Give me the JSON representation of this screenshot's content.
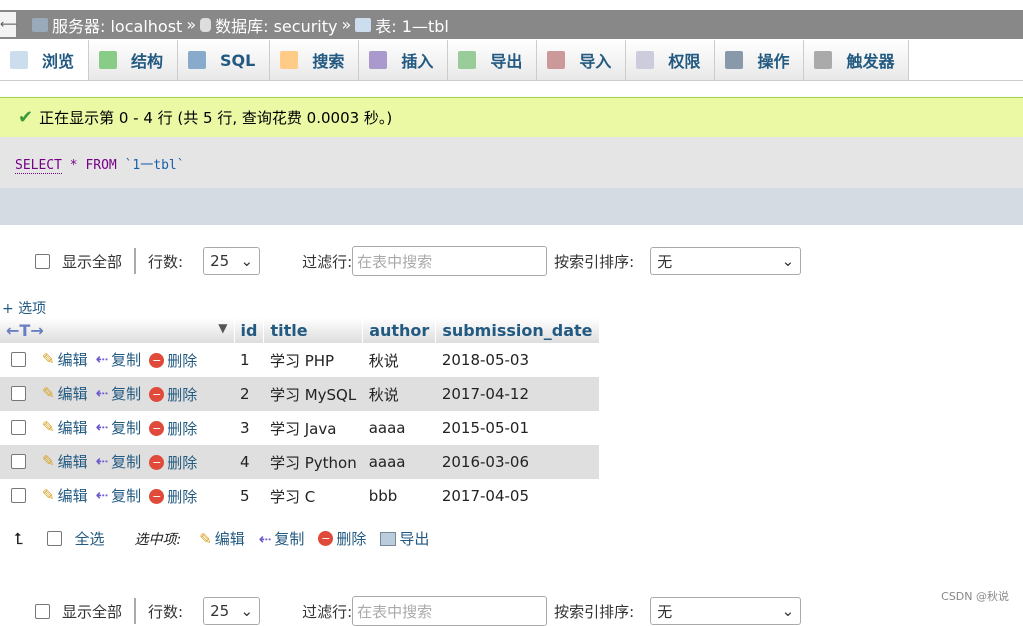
{
  "breadcrumb": {
    "server": "服务器: localhost",
    "database": "数据库: security",
    "table": "表: 1—tbl",
    "sep": "»"
  },
  "tabs": [
    {
      "label": "浏览",
      "icon": "browse-icon"
    },
    {
      "label": "结构",
      "icon": "structure-icon"
    },
    {
      "label": "SQL",
      "icon": "sql-icon"
    },
    {
      "label": "搜索",
      "icon": "search-icon"
    },
    {
      "label": "插入",
      "icon": "insert-icon"
    },
    {
      "label": "导出",
      "icon": "export-icon"
    },
    {
      "label": "导入",
      "icon": "import-icon"
    },
    {
      "label": "权限",
      "icon": "privileges-icon"
    },
    {
      "label": "操作",
      "icon": "wrench-icon"
    },
    {
      "label": "触发器",
      "icon": "triggers-icon"
    }
  ],
  "message": "正在显示第 0 - 4 行 (共 5 行, 查询花费 0.0003 秒。)",
  "sql": {
    "select": "SELECT",
    "star": "*",
    "from": "FROM",
    "table": "`1一tbl`"
  },
  "controls": {
    "show_all": "显示全部",
    "rows_label": "行数:",
    "rows_value": "25",
    "filter_label": "过滤行:",
    "filter_placeholder": "在表中搜索",
    "sort_label": "按索引排序:",
    "sort_value": "无"
  },
  "options_link": "+ 选项",
  "table": {
    "columns": [
      "id",
      "title",
      "author",
      "submission_date"
    ],
    "actions": {
      "edit": "编辑",
      "copy": "复制",
      "delete": "删除"
    },
    "rows": [
      [
        "1",
        "学习 PHP",
        "秋说",
        "2018-05-03"
      ],
      [
        "2",
        "学习 MySQL",
        "秋说",
        "2017-04-12"
      ],
      [
        "3",
        "学习 Java",
        "aaaa",
        "2015-05-01"
      ],
      [
        "4",
        "学习 Python",
        "aaaa",
        "2016-03-06"
      ],
      [
        "5",
        "学习 C",
        "bbb",
        "2017-04-05"
      ]
    ]
  },
  "bottom": {
    "select_all": "全选",
    "with_selected": "选中项:",
    "edit": "编辑",
    "copy": "复制",
    "delete": "删除",
    "export": "导出"
  },
  "watermark": "CSDN @秋说"
}
